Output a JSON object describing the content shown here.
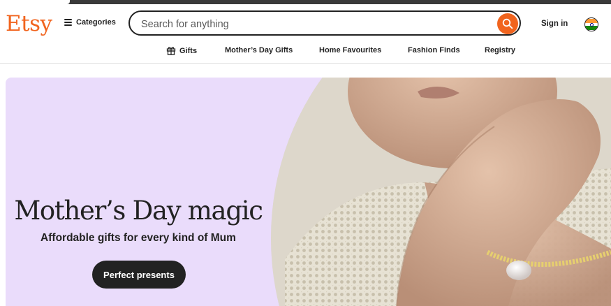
{
  "header": {
    "logo": "Etsy",
    "categories_label": "Categories",
    "search_placeholder": "Search for anything",
    "search_value": "",
    "signin_label": "Sign in",
    "region_flag": "india-flag-icon"
  },
  "nav": {
    "items": [
      {
        "label": "Gifts",
        "icon": "gift-icon"
      },
      {
        "label": "Mother’s Day Gifts"
      },
      {
        "label": "Home Favourites"
      },
      {
        "label": "Fashion Finds"
      },
      {
        "label": "Registry"
      }
    ]
  },
  "hero": {
    "title": "Mother’s Day magic",
    "subtitle": "Affordable gifts for every kind of Mum",
    "cta_label": "Perfect presents"
  },
  "colors": {
    "brand": "#f1641e",
    "hero_bg": "#eadcfb",
    "text": "#222222",
    "button_bg": "#222222"
  }
}
